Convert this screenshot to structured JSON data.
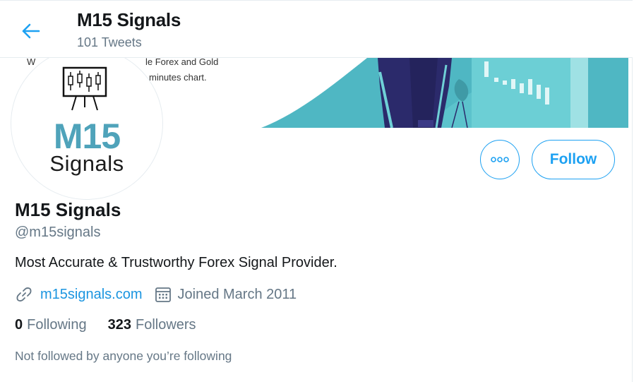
{
  "header": {
    "title": "M15 Signals",
    "tweet_count": "101 Tweets",
    "back_icon": "arrow-left-icon"
  },
  "banner": {
    "text_line1_left": "W",
    "text_line1_right": "le Forex and Gold",
    "text_line2": "minutes chart.",
    "colors": {
      "teal": "#4fb7c3",
      "navy": "#2b2a6b",
      "light_teal": "#6fd0d6"
    }
  },
  "avatar": {
    "logo_big": "M15",
    "logo_small": "Signals",
    "colors": {
      "m15": "#4fa3ba",
      "signals": "#1b1b1b"
    }
  },
  "actions": {
    "more_icon": "more-horizontal-icon",
    "follow_label": "Follow"
  },
  "profile": {
    "name": "M15 Signals",
    "handle": "@m15signals",
    "bio": "Most Accurate & Trustworthy Forex Signal Provider.",
    "website": "m15signals.com",
    "joined": "Joined March 2011",
    "following_count": "0",
    "following_label": "Following",
    "followers_count": "323",
    "followers_label": "Followers",
    "not_followed_text": "Not followed by anyone you’re following"
  },
  "theme": {
    "accent": "#1da1f2",
    "link": "#1b95e0",
    "secondary_text": "#657786",
    "primary_text": "#14171a"
  }
}
